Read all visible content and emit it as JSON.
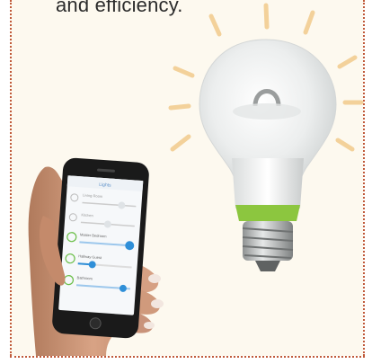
{
  "caption": {
    "text": "and efficiency."
  },
  "phone": {
    "header_title": "Lights",
    "rows": [
      {
        "label": "Living Room"
      },
      {
        "label": "Kitchen"
      },
      {
        "label": "Master Bedroom"
      },
      {
        "label": "Hallway Guest"
      },
      {
        "label": "Bathroom"
      }
    ]
  },
  "colors": {
    "border": "#c05a3a",
    "ray": "#f3d19a",
    "bulb_band": "#8cc63f",
    "slider_active": "#2f8fd8"
  }
}
